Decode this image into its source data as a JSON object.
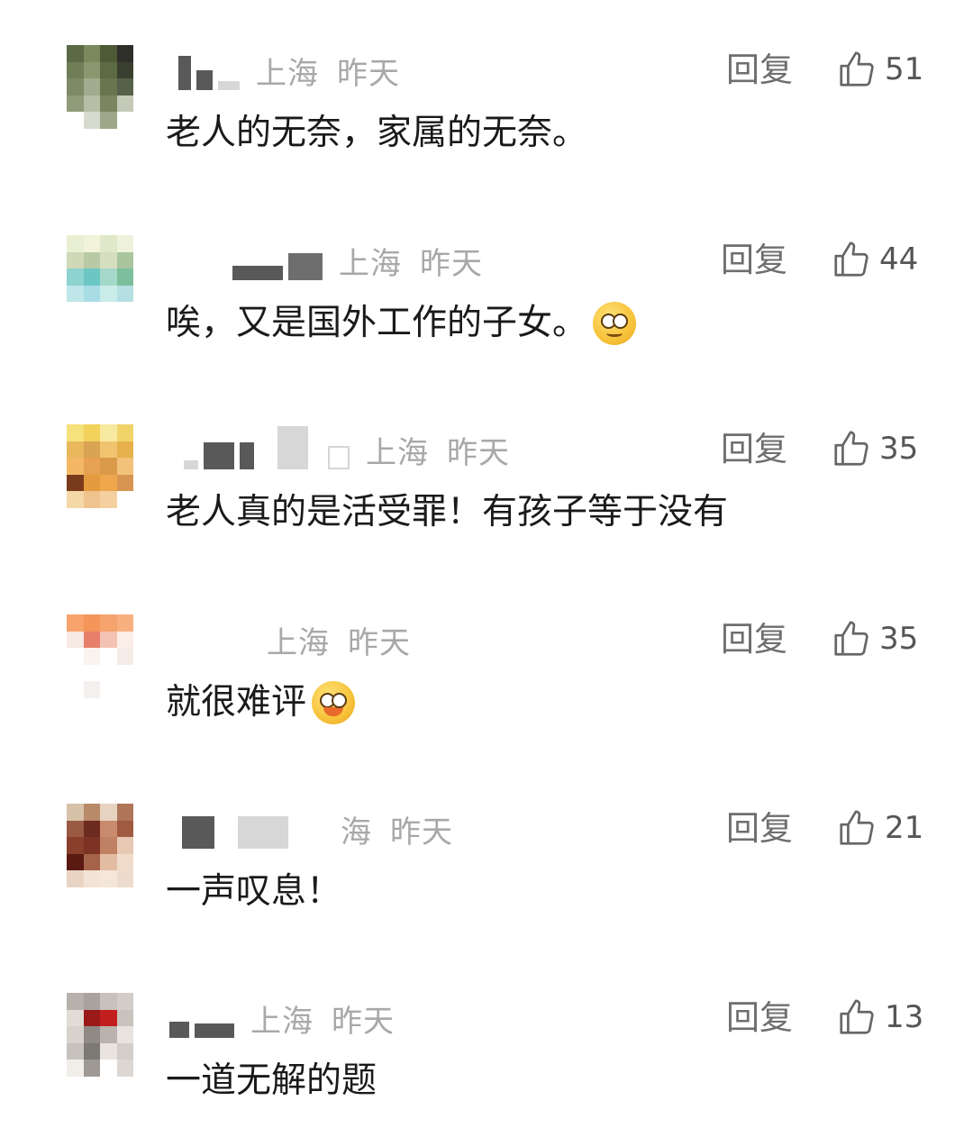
{
  "comments": [
    {
      "location": "上海",
      "time": "昨天",
      "reply_label": "回复",
      "likes": "51",
      "text": "老人的无奈，家属的无奈。",
      "emoji": null,
      "avatar_colors": [
        "#5b6a45",
        "#7a8a5e",
        "#4e5a36",
        "#2f2f2a",
        "#6f7e57",
        "#8a9870",
        "#5c6b44",
        "#3a3f30",
        "#7d8a65",
        "#a1ab8d",
        "#68764f",
        "#556148",
        "#8f9a79",
        "#b7bea6",
        "#7b8660",
        "#c4c9b8",
        "#ffffff",
        "#d7dbcf",
        "#9ea789",
        "#ffffff"
      ]
    },
    {
      "location": "上海",
      "time": "昨天",
      "reply_label": "回复",
      "likes": "44",
      "text": "唉，又是国外工作的子女。",
      "emoji": "worried-face-emoji",
      "avatar_colors": [
        "#e9efd2",
        "#f1f3da",
        "#dfe8c8",
        "#eef2dc",
        "#cfd9b8",
        "#b8c9a6",
        "#d6dec0",
        "#a9c59e",
        "#8dd3cf",
        "#6cc7c4",
        "#a4d8c9",
        "#7dbf9c",
        "#bfe6e8",
        "#a8dde6",
        "#c9ece9",
        "#b6dfe3",
        "#ffffff",
        "#ffffff",
        "#ffffff",
        "#ffffff"
      ]
    },
    {
      "location": "上海",
      "time": "昨天",
      "reply_label": "回复",
      "likes": "35",
      "text": "老人真的是活受罪！有孩子等于没有",
      "emoji": null,
      "avatar_colors": [
        "#f6e27a",
        "#f3d25c",
        "#f8e9a0",
        "#f0d46a",
        "#e9b85c",
        "#d9a453",
        "#f0c36e",
        "#e6b14d",
        "#f3b766",
        "#e7a152",
        "#d99a4a",
        "#f2c27a",
        "#7a3b1c",
        "#e49a3e",
        "#f0a64c",
        "#d69550",
        "#f5d8a8",
        "#f0c38e",
        "#f4cfa0",
        "#ffffff"
      ]
    },
    {
      "location": "上海",
      "time": "昨天",
      "reply_label": "回复",
      "likes": "35",
      "text": "就很难评",
      "emoji": "drooling-face-emoji",
      "avatar_colors": [
        "#f7a36b",
        "#f5955a",
        "#f6a36e",
        "#f8b080",
        "#f7e9e4",
        "#e87f6a",
        "#f3c2b3",
        "#fbeee9",
        "#ffffff",
        "#fbf3f0",
        "#ffffff",
        "#f5ece8",
        "#ffffff",
        "#ffffff",
        "#ffffff",
        "#ffffff",
        "#ffffff",
        "#f3f0ee",
        "#ffffff",
        "#ffffff"
      ]
    },
    {
      "location": "海",
      "time": "昨天",
      "reply_label": "回复",
      "likes": "21",
      "text": "一声叹息！",
      "emoji": null,
      "avatar_colors": [
        "#d7c1a8",
        "#b88a6a",
        "#e6d3c0",
        "#b0765a",
        "#9a5a44",
        "#6d2a1e",
        "#c98a6e",
        "#a05a40",
        "#8a3f2c",
        "#7c3324",
        "#c08063",
        "#e7c8b2",
        "#5a1a12",
        "#a5644a",
        "#e2bda3",
        "#f1dccc",
        "#e9d4c4",
        "#f3e2d6",
        "#f5e6da",
        "#eddccd"
      ]
    },
    {
      "location": "上海",
      "time": "昨天",
      "reply_label": "回复",
      "likes": "13",
      "text": "一道无解的题",
      "emoji": null,
      "avatar_colors": [
        "#b7b1ab",
        "#a8a39f",
        "#c7c2bd",
        "#d2cdc8",
        "#e2dcd6",
        "#9a1a1a",
        "#c21e1e",
        "#c9c3be",
        "#d8d2cc",
        "#8f8a86",
        "#b9b3ae",
        "#e8e3de",
        "#c7c2bd",
        "#7c7874",
        "#e9e4e0",
        "#d3cec9",
        "#f1ede9",
        "#9e9995",
        "#ffffff",
        "#dcd7d2"
      ]
    }
  ]
}
